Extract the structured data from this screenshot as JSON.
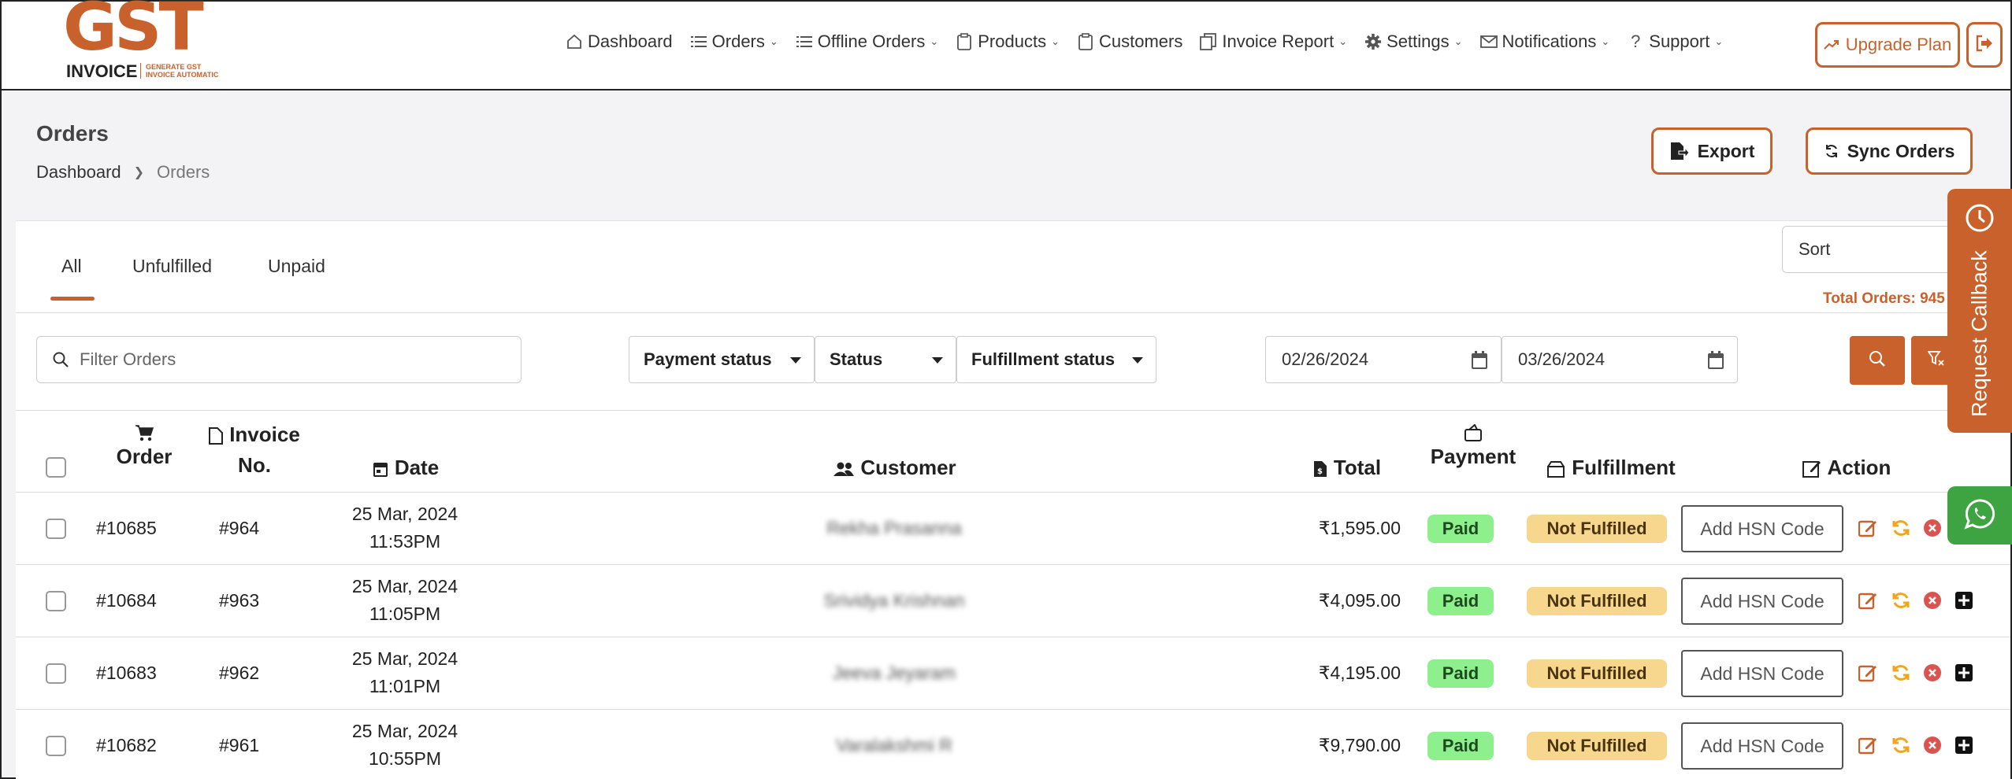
{
  "brand": {
    "logo_text": "GST",
    "logo_sub": "INVOICE",
    "tagline_1": "GENERATE GST",
    "tagline_2": "INVOICE AUTOMATIC",
    "accent": "#c9612c"
  },
  "nav": {
    "items": [
      {
        "label": "Dashboard",
        "icon": "home-icon",
        "dropdown": false
      },
      {
        "label": "Orders",
        "icon": "list-icon",
        "dropdown": true
      },
      {
        "label": "Offline Orders",
        "icon": "list-icon",
        "dropdown": true
      },
      {
        "label": "Products",
        "icon": "clipboard-icon",
        "dropdown": true
      },
      {
        "label": "Customers",
        "icon": "clipboard-icon",
        "dropdown": false
      },
      {
        "label": "Invoice Report",
        "icon": "documents-icon",
        "dropdown": true
      },
      {
        "label": "Settings",
        "icon": "gear-icon",
        "dropdown": true
      },
      {
        "label": "Notifications",
        "icon": "envelope-icon",
        "dropdown": true
      },
      {
        "label": "Support",
        "icon": "question-icon",
        "dropdown": true
      }
    ],
    "upgrade_label": "Upgrade Plan"
  },
  "header": {
    "title": "Orders",
    "breadcrumb": {
      "root": "Dashboard",
      "current": "Orders"
    },
    "export_label": "Export",
    "sync_label": "Sync Orders"
  },
  "tabs": {
    "all": "All",
    "unfulfilled": "Unfulfilled",
    "unpaid": "Unpaid"
  },
  "sort": {
    "selected": "Sort"
  },
  "total_orders_text": "Total Orders: 945",
  "filters": {
    "search_placeholder": "Filter Orders",
    "payment_status": "Payment status",
    "status": "Status",
    "fulfillment_status": "Fulfillment status",
    "date_from": "02/26/2024",
    "date_to": "03/26/2024"
  },
  "table": {
    "headers": {
      "order": "Order",
      "invoice_1": "Invoice",
      "invoice_2": "No.",
      "date": "Date",
      "customer": "Customer",
      "total": "Total",
      "payment": "Payment",
      "fulfillment": "Fulfillment",
      "action": "Action"
    },
    "hsn_label": "Add HSN Code",
    "rows": [
      {
        "order": "#10685",
        "invoice": "#964",
        "date": "25 Mar, 2024",
        "time": "11:53PM",
        "customer": "Rekha Prasanna",
        "total": "₹1,595.00",
        "payment": "Paid",
        "fulfillment": "Not Fulfilled"
      },
      {
        "order": "#10684",
        "invoice": "#963",
        "date": "25 Mar, 2024",
        "time": "11:05PM",
        "customer": "Srividya Krishnan",
        "total": "₹4,095.00",
        "payment": "Paid",
        "fulfillment": "Not Fulfilled"
      },
      {
        "order": "#10683",
        "invoice": "#962",
        "date": "25 Mar, 2024",
        "time": "11:01PM",
        "customer": "Jeeva Jeyaram",
        "total": "₹4,195.00",
        "payment": "Paid",
        "fulfillment": "Not Fulfilled"
      },
      {
        "order": "#10682",
        "invoice": "#961",
        "date": "25 Mar, 2024",
        "time": "10:55PM",
        "customer": "Varalakshmi R",
        "total": "₹9,790.00",
        "payment": "Paid",
        "fulfillment": "Not Fulfilled"
      }
    ]
  },
  "side": {
    "callback_label": "Request Callback",
    "whatsapp_icon": "whatsapp-icon"
  }
}
